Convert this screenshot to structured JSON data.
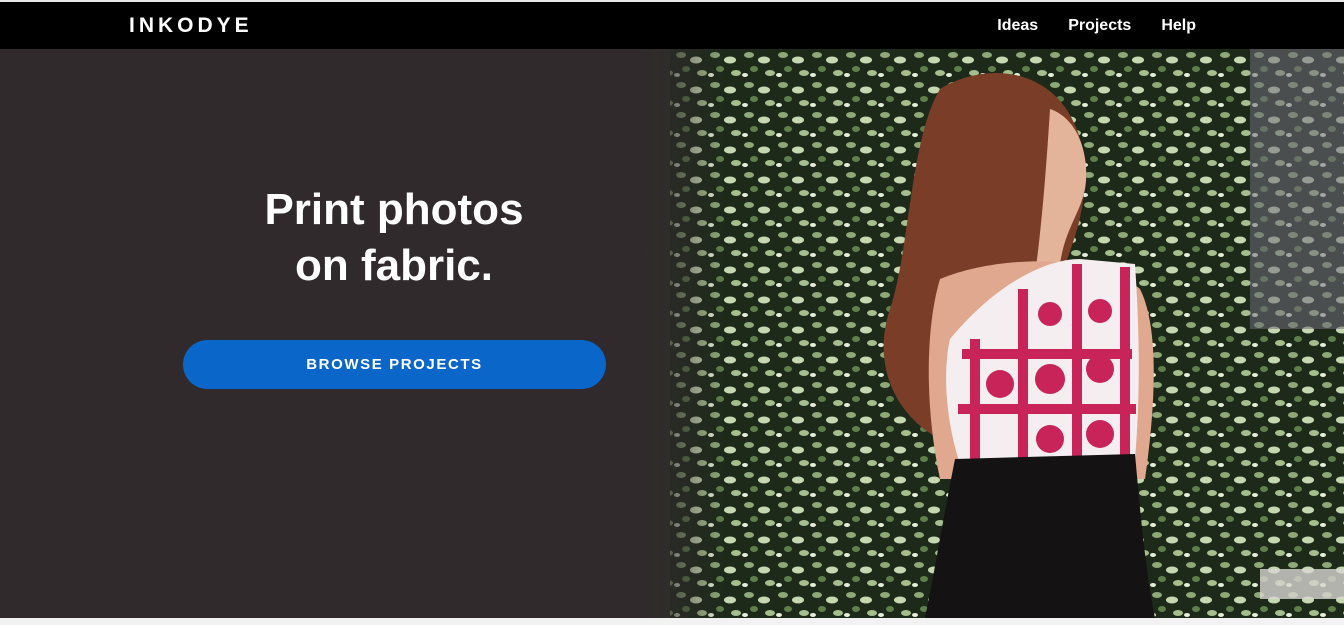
{
  "header": {
    "logo": "INKODYE",
    "nav": [
      {
        "label": "Ideas"
      },
      {
        "label": "Projects"
      },
      {
        "label": "Help"
      }
    ]
  },
  "hero": {
    "headline_line1": "Print photos",
    "headline_line2": "on fabric.",
    "cta_label": "BROWSE PROJECTS",
    "image": "woman-in-printed-top-against-ivy-photo"
  },
  "colors": {
    "topbar": "#000000",
    "hero_background": "#302a2c",
    "cta": "#0a66c8",
    "text": "#ffffff"
  }
}
